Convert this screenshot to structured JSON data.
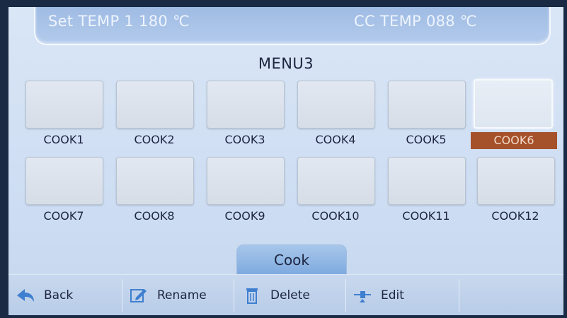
{
  "header": {
    "set_temp": "Set TEMP 1 180 ℃",
    "cc_temp": "CC TEMP 088 ℃"
  },
  "menu_title": "MENU3",
  "cooks": [
    {
      "label": "COOK1",
      "selected": false
    },
    {
      "label": "COOK2",
      "selected": false
    },
    {
      "label": "COOK3",
      "selected": false
    },
    {
      "label": "COOK4",
      "selected": false
    },
    {
      "label": "COOK5",
      "selected": false
    },
    {
      "label": "COOK6",
      "selected": true
    },
    {
      "label": "COOK7",
      "selected": false
    },
    {
      "label": "COOK8",
      "selected": false
    },
    {
      "label": "COOK9",
      "selected": false
    },
    {
      "label": "COOK10",
      "selected": false
    },
    {
      "label": "COOK11",
      "selected": false
    },
    {
      "label": "COOK12",
      "selected": false
    }
  ],
  "cook_tab": "Cook",
  "toolbar": {
    "back": "Back",
    "rename": "Rename",
    "delete": "Delete",
    "edit": "Edit"
  },
  "colors": {
    "selected_label_bg": "#a5512a",
    "screen_bg": "#d9e6f6",
    "icon_blue": "#3f7fd0"
  },
  "icons": {
    "back": "back-arrow-icon",
    "rename": "rename-pencil-icon",
    "delete": "trash-icon",
    "edit": "edit-slider-icon"
  }
}
